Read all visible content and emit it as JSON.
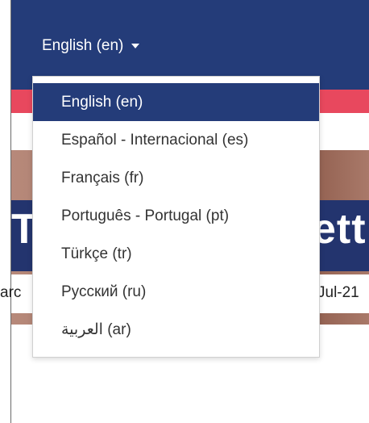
{
  "navbar": {
    "language_toggle": "English (en)",
    "bg_color": "#243c79"
  },
  "banner": {
    "title_left_fragment": "T",
    "title_right_fragment": "etti",
    "subtitle_left_fragment": "arc",
    "subtitle_right_fragment": "Jul-21"
  },
  "language_menu": {
    "items": [
      {
        "label": "English (en)",
        "active": true
      },
      {
        "label": "Español - Internacional (es)",
        "active": false
      },
      {
        "label": "Français (fr)",
        "active": false
      },
      {
        "label": "Português - Portugal (pt)",
        "active": false
      },
      {
        "label": "Türkçe (tr)",
        "active": false
      },
      {
        "label": "Русский (ru)",
        "active": false
      },
      {
        "label": "العربية (ar)",
        "active": false
      }
    ]
  }
}
